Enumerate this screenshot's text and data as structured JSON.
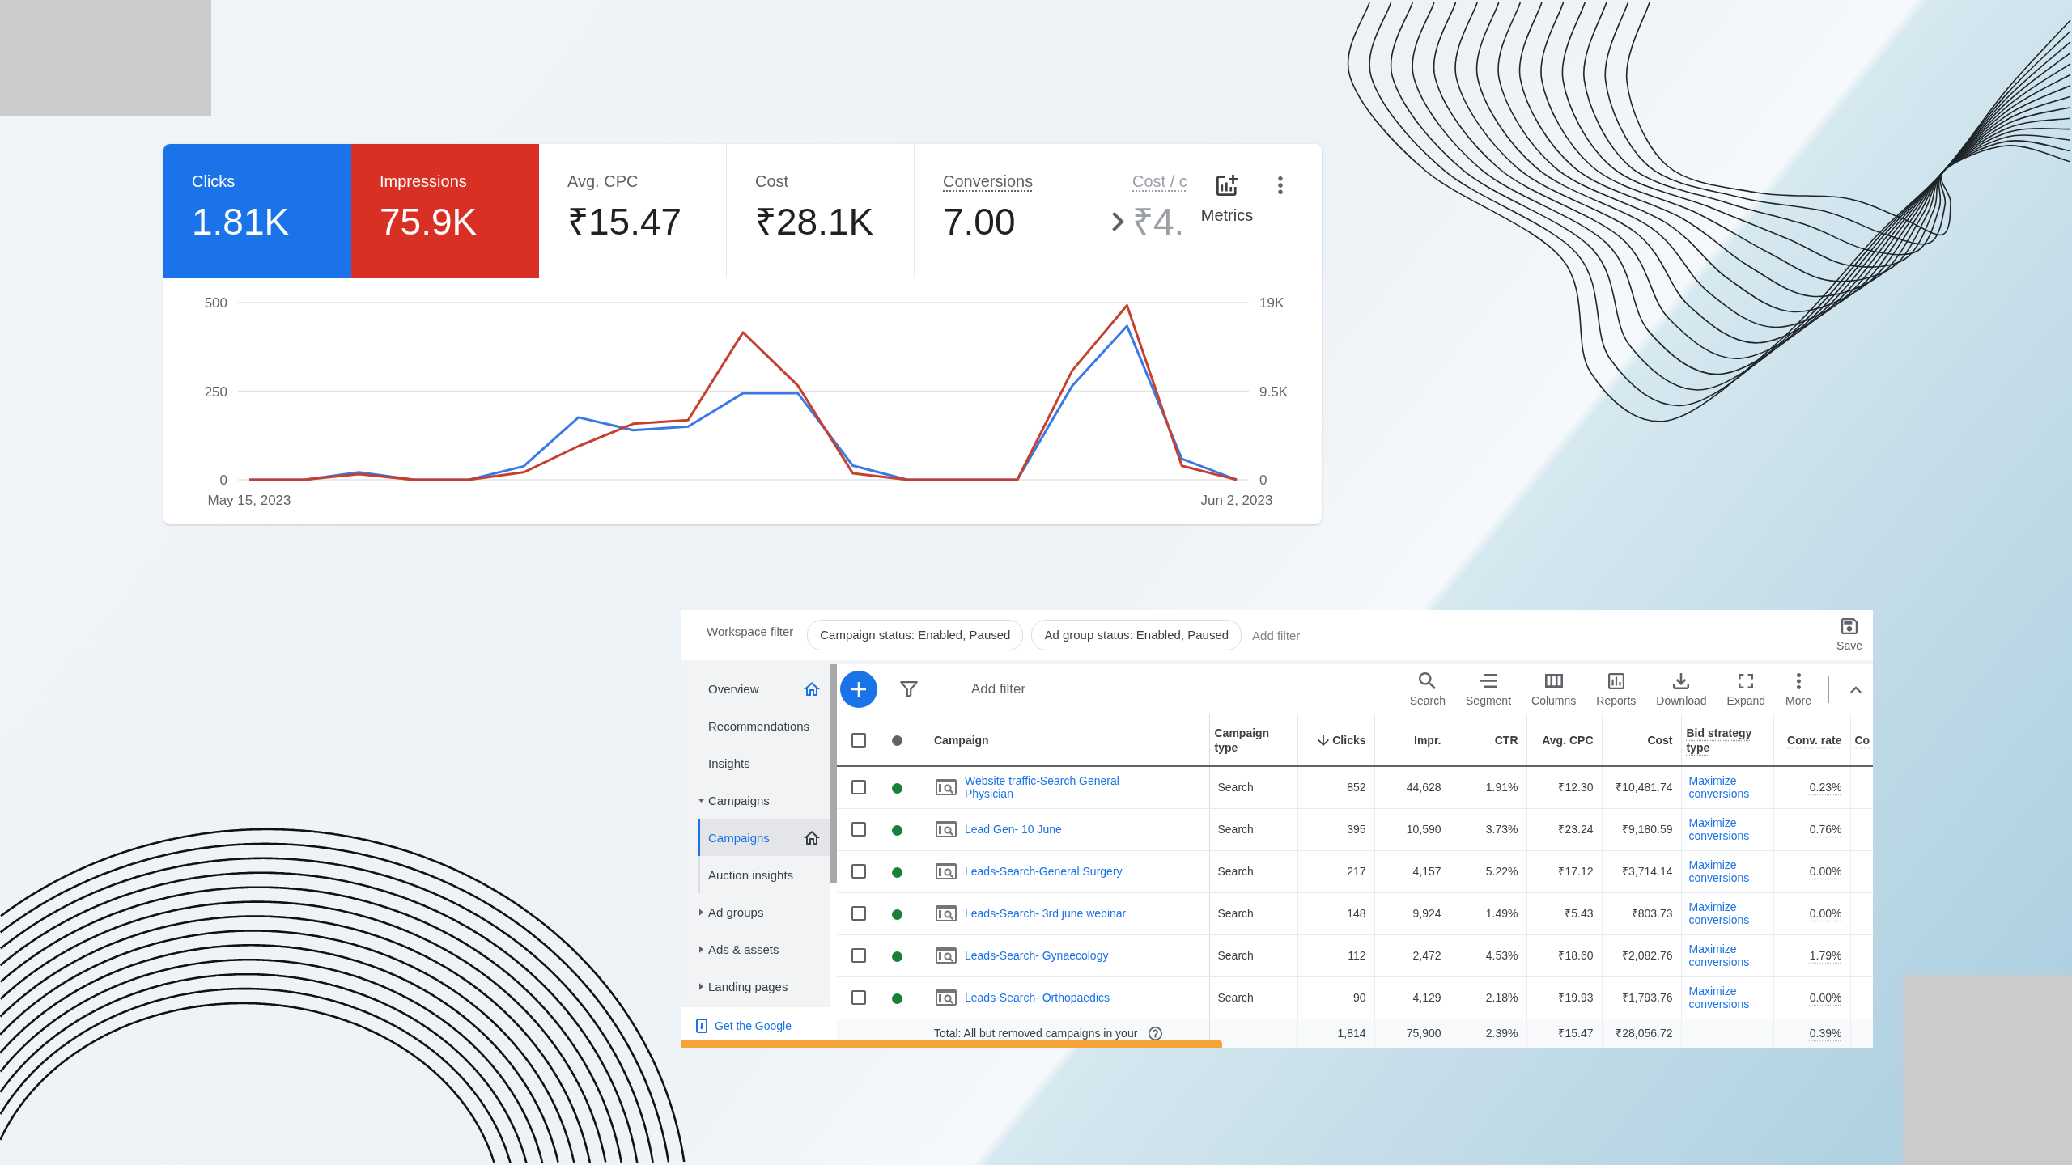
{
  "metrics_card": {
    "tiles": [
      {
        "label": "Clicks",
        "value": "1.81K",
        "selected": true,
        "color": "#1a73e8",
        "underlined": false,
        "faded": false
      },
      {
        "label": "Impressions",
        "value": "75.9K",
        "selected": true,
        "color": "#d93025",
        "underlined": false,
        "faded": false
      },
      {
        "label": "Avg. CPC",
        "value": "₹15.47",
        "selected": false,
        "underlined": false,
        "faded": false
      },
      {
        "label": "Cost",
        "value": "₹28.1K",
        "selected": false,
        "underlined": false,
        "faded": false
      },
      {
        "label": "Conversions",
        "value": "7.00",
        "selected": false,
        "underlined": true,
        "faded": false
      },
      {
        "label": "Cost / c",
        "value": "₹4.",
        "selected": false,
        "underlined": true,
        "faded": true
      }
    ],
    "metrics_button": "Metrics",
    "chart_data": {
      "type": "line",
      "categories": [
        "May 15, 2023",
        null,
        null,
        null,
        null,
        null,
        null,
        null,
        null,
        null,
        null,
        null,
        null,
        null,
        null,
        null,
        null,
        null,
        "Jun 2, 2023"
      ],
      "ylim": [
        0,
        500
      ],
      "yticks": [
        0,
        250,
        500
      ],
      "y2lim": [
        0,
        19000
      ],
      "y2ticks": [
        0,
        {
          "value": 9500,
          "label": "9.5K"
        },
        {
          "value": 19000,
          "label": "19K"
        }
      ],
      "series": [
        {
          "color": "#3b78e7",
          "values": [
            0,
            0,
            21,
            0,
            0,
            38,
            176,
            140,
            150,
            244,
            244,
            40,
            0,
            0,
            0,
            265,
            434,
            59,
            0
          ]
        },
        {
          "color": "#c5402f",
          "axis": "y2",
          "values": [
            0,
            0,
            600,
            0,
            0,
            800,
            3600,
            6000,
            6400,
            15800,
            10100,
            700,
            0,
            0,
            0,
            11700,
            18700,
            1500,
            0
          ]
        }
      ]
    }
  },
  "campaigns_panel": {
    "workspace_filter": {
      "label": "Workspace filter",
      "chips": [
        "Campaign status: Enabled, Paused",
        "Ad group status: Enabled, Paused"
      ],
      "add_filter": "Add filter",
      "save": "Save"
    },
    "sidebar": {
      "items": [
        {
          "label": "Overview",
          "kind": "page",
          "selected": false,
          "home": true
        },
        {
          "label": "Recommendations",
          "kind": "page",
          "selected": false,
          "home": false
        },
        {
          "label": "Insights",
          "kind": "page",
          "selected": false,
          "home": false
        },
        {
          "label": "Campaigns",
          "kind": "group",
          "selected": false,
          "home": false,
          "expanded": true,
          "children": [
            {
              "label": "Campaigns",
              "kind": "page",
              "selected": true,
              "home": true
            },
            {
              "label": "Auction insights",
              "kind": "page",
              "selected": false,
              "home": false
            }
          ]
        },
        {
          "label": "Ad groups",
          "kind": "group",
          "selected": false,
          "home": false,
          "expanded": false
        },
        {
          "label": "Ads & assets",
          "kind": "group",
          "selected": false,
          "home": false,
          "expanded": false
        },
        {
          "label": "Landing pages",
          "kind": "group",
          "selected": false,
          "home": false,
          "expanded": false
        }
      ],
      "app_link": "Get the Google"
    },
    "toolbar": {
      "add_filter": "Add filter",
      "tools": [
        {
          "kind": "search",
          "label": "Search"
        },
        {
          "kind": "segment",
          "label": "Segment"
        },
        {
          "kind": "columns",
          "label": "Columns"
        },
        {
          "kind": "reports",
          "label": "Reports"
        },
        {
          "kind": "download",
          "label": "Download"
        },
        {
          "kind": "expand",
          "label": "Expand"
        },
        {
          "kind": "more",
          "label": "More"
        }
      ]
    },
    "table": {
      "select_all_checked": false,
      "columns": [
        {
          "label": "Campaign",
          "kind": "campaign",
          "sorted": false,
          "underlined": false
        },
        {
          "label": "Campaign type",
          "kind": "text",
          "sorted": false,
          "underlined": false
        },
        {
          "label": "Clicks",
          "kind": "number",
          "sorted": true,
          "underlined": false
        },
        {
          "label": "Impr.",
          "kind": "number",
          "sorted": false,
          "underlined": false
        },
        {
          "label": "CTR",
          "kind": "number",
          "sorted": false,
          "underlined": false
        },
        {
          "label": "Avg. CPC",
          "kind": "number",
          "sorted": false,
          "underlined": false
        },
        {
          "label": "Cost",
          "kind": "number",
          "sorted": false,
          "underlined": false
        },
        {
          "label": "Bid strategy type",
          "kind": "link",
          "sorted": false,
          "underlined": true
        },
        {
          "label": "Conv. rate",
          "kind": "number",
          "sorted": false,
          "underlined": true
        },
        {
          "label": "Co",
          "kind": "number",
          "sorted": false,
          "underlined": true
        }
      ],
      "rows": [
        {
          "checked": false,
          "color": "#188038",
          "cells": [
            "Website traffic-Search General Physician",
            "Search",
            "852",
            "44,628",
            "1.91%",
            "₹12.30",
            "₹10,481.74",
            "Maximize conversions",
            "0.23%"
          ]
        },
        {
          "checked": false,
          "color": "#188038",
          "cells": [
            "Lead Gen- 10 June",
            "Search",
            "395",
            "10,590",
            "3.73%",
            "₹23.24",
            "₹9,180.59",
            "Maximize conversions",
            "0.76%"
          ]
        },
        {
          "checked": false,
          "color": "#188038",
          "cells": [
            "Leads-Search-General Surgery",
            "Search",
            "217",
            "4,157",
            "5.22%",
            "₹17.12",
            "₹3,714.14",
            "Maximize conversions",
            "0.00%"
          ]
        },
        {
          "checked": false,
          "color": "#188038",
          "cells": [
            "Leads-Search- 3rd june webinar",
            "Search",
            "148",
            "9,924",
            "1.49%",
            "₹5.43",
            "₹803.73",
            "Maximize conversions",
            "0.00%"
          ]
        },
        {
          "checked": false,
          "color": "#188038",
          "cells": [
            "Leads-Search- Gynaecology",
            "Search",
            "112",
            "2,472",
            "4.53%",
            "₹18.60",
            "₹2,082.76",
            "Maximize conversions",
            "1.79%"
          ]
        },
        {
          "checked": false,
          "color": "#188038",
          "cells": [
            "Leads-Search- Orthopaedics",
            "Search",
            "90",
            "4,129",
            "2.18%",
            "₹19.93",
            "₹1,793.76",
            "Maximize conversions",
            "0.00%"
          ]
        }
      ],
      "total": {
        "label": "Total: All but removed campaigns in your",
        "cells": [
          null,
          null,
          "1,814",
          "75,900",
          "2.39%",
          "₹15.47",
          "₹28,056.72",
          null,
          "0.39%"
        ]
      }
    }
  }
}
